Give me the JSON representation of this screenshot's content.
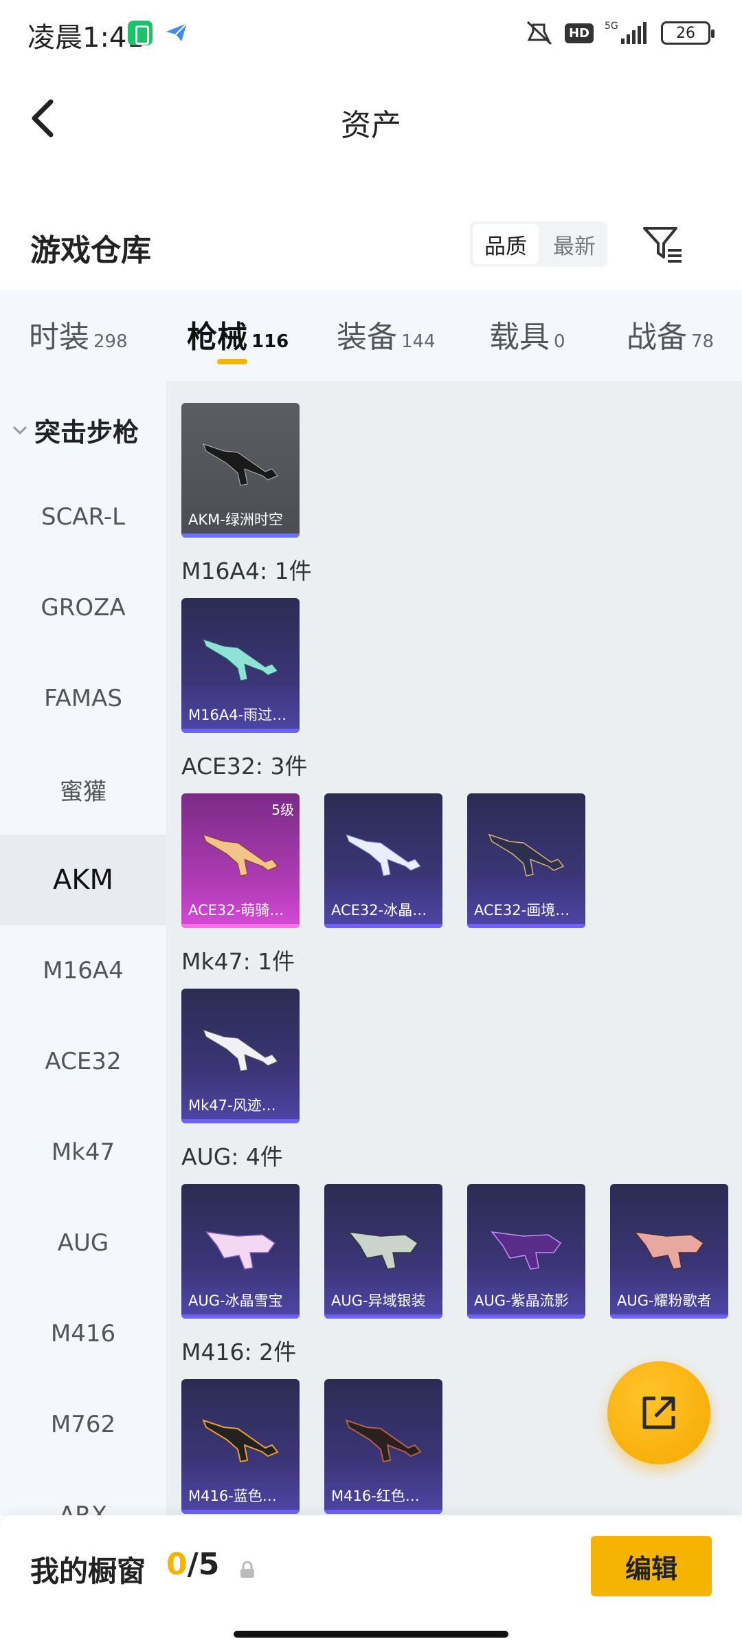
{
  "status_bar": {
    "time": "凌晨1:41",
    "hd": "HD",
    "network": "5G",
    "battery": "26"
  },
  "header": {
    "title": "资产"
  },
  "warehouse": {
    "title": "游戏仓库",
    "sort_options": [
      "品质",
      "最新"
    ],
    "active_sort": "品质"
  },
  "categories": [
    {
      "label": "时装",
      "count": "298"
    },
    {
      "label": "枪械",
      "count": "116"
    },
    {
      "label": "装备",
      "count": "144"
    },
    {
      "label": "载具",
      "count": "0"
    },
    {
      "label": "战备",
      "count": "78"
    }
  ],
  "sidebar": {
    "group": "突击步枪",
    "items": [
      "SCAR-L",
      "GROZA",
      "FAMAS",
      "蜜獾",
      "AKM",
      "M16A4",
      "ACE32",
      "Mk47",
      "AUG",
      "M416",
      "M762",
      "ARX"
    ],
    "active": "AKM"
  },
  "sections": [
    {
      "title": "",
      "items": [
        {
          "name": "AKM-绿洲时空",
          "style": "gray",
          "level": ""
        }
      ]
    },
    {
      "title": "M16A4: 1件",
      "items": [
        {
          "name": "M16A4-雨过…",
          "style": "purple",
          "level": ""
        }
      ]
    },
    {
      "title": "ACE32: 3件",
      "items": [
        {
          "name": "ACE32-萌骑…",
          "style": "pink",
          "level": "5级"
        },
        {
          "name": "ACE32-冰晶…",
          "style": "purple",
          "level": ""
        },
        {
          "name": "ACE32-画境…",
          "style": "purple",
          "level": ""
        }
      ]
    },
    {
      "title": "Mk47: 1件",
      "items": [
        {
          "name": "Mk47-风迹…",
          "style": "purple",
          "level": ""
        }
      ]
    },
    {
      "title": "AUG: 4件",
      "items": [
        {
          "name": "AUG-冰晶雪宝",
          "style": "purple",
          "level": ""
        },
        {
          "name": "AUG-异域银装",
          "style": "purple",
          "level": ""
        },
        {
          "name": "AUG-紫晶流影",
          "style": "purple",
          "level": ""
        },
        {
          "name": "AUG-耀粉歌者",
          "style": "purple",
          "level": ""
        }
      ]
    },
    {
      "title": "M416: 2件",
      "items": [
        {
          "name": "M416-蓝色…",
          "style": "purple",
          "level": ""
        },
        {
          "name": "M416-红色…",
          "style": "purple",
          "level": ""
        }
      ]
    }
  ],
  "bottom": {
    "showcase_label": "我的橱窗",
    "current": "0",
    "separator": "/",
    "max": "5",
    "edit_label": "编辑"
  },
  "colors": {
    "accent": "#f5b400",
    "purple_card": "#3b3576",
    "pink_card": "#b23db8"
  }
}
